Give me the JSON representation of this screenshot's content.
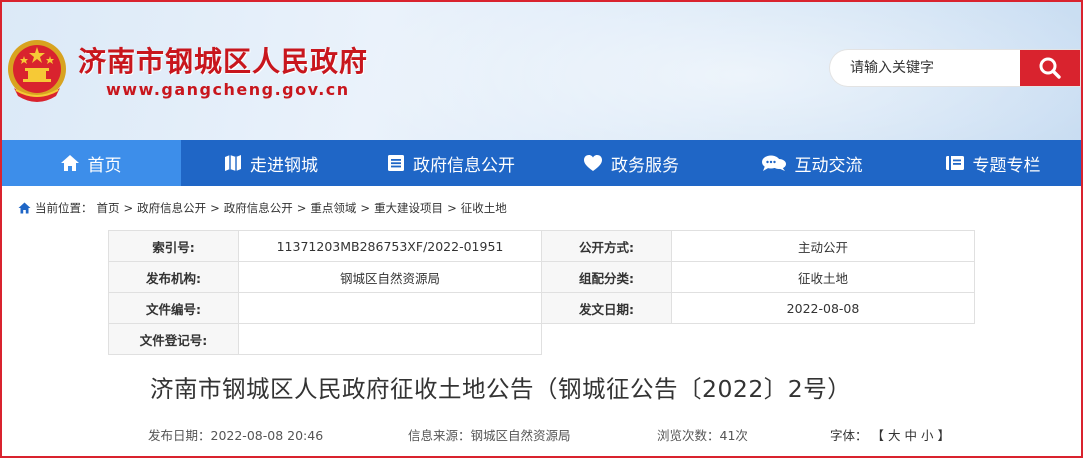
{
  "header": {
    "site_title": "济南市钢城区人民政府",
    "site_url": "www.gangcheng.gov.cn",
    "emblem_icon": "national-emblem-icon",
    "search": {
      "placeholder": "请输入关键字",
      "value": "",
      "button_icon": "search-icon"
    }
  },
  "nav": {
    "items": [
      {
        "label": "首页",
        "icon": "home-icon",
        "active": true
      },
      {
        "label": "走进钢城",
        "icon": "map-icon",
        "active": false
      },
      {
        "label": "政府信息公开",
        "icon": "document-icon",
        "active": false
      },
      {
        "label": "政务服务",
        "icon": "heart-icon",
        "active": false
      },
      {
        "label": "互动交流",
        "icon": "chat-icon",
        "active": false
      },
      {
        "label": "专题专栏",
        "icon": "column-icon",
        "active": false
      }
    ]
  },
  "breadcrumb": {
    "prefix": "当前位置：",
    "items": [
      "首页",
      "政府信息公开",
      "政府信息公开",
      "重点领域",
      "重大建设项目",
      "征收土地"
    ],
    "separator": ">"
  },
  "info": {
    "index_label": "索引号:",
    "index_value": "11371203MB286753XF/2022-01951",
    "mode_label": "公开方式:",
    "mode_value": "主动公开",
    "org_label": "发布机构:",
    "org_value": "钢城区自然资源局",
    "category_label": "组配分类:",
    "category_value": "征收土地",
    "doc_no_label": "文件编号:",
    "doc_no_value": "",
    "date_label": "发文日期:",
    "date_value": "2022-08-08",
    "reg_label": "文件登记号:",
    "reg_value": ""
  },
  "article": {
    "title": "济南市钢城区人民政府征收土地公告（钢城征公告〔2022〕2号）",
    "publish_date": "发布日期：2022-08-08 20:46",
    "source": "信息来源：钢城区自然资源局",
    "views": "浏览次数：41次",
    "font_label": "字体：",
    "font_open": "【",
    "font_large": "大",
    "font_medium": "中",
    "font_small": "小",
    "font_close": "】"
  },
  "colors": {
    "brand_red": "#c8161d",
    "nav_blue": "#1f66c6",
    "nav_active": "#3d8eea"
  }
}
